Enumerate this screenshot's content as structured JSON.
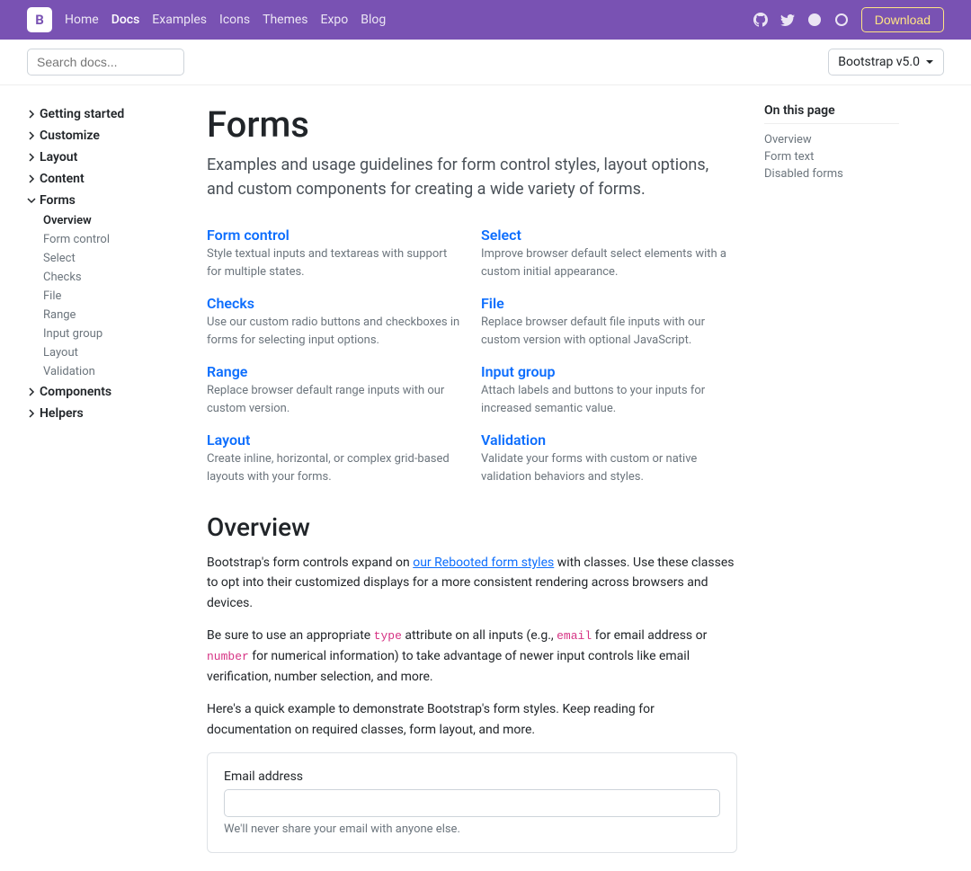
{
  "navbar": {
    "brand": "B",
    "links": [
      "Home",
      "Docs",
      "Examples",
      "Icons",
      "Themes",
      "Expo",
      "Blog"
    ],
    "active": "Docs",
    "download": "Download"
  },
  "subnav": {
    "search_placeholder": "Search docs...",
    "version": "Bootstrap v5.0"
  },
  "sidebar": {
    "sections": [
      "Getting started",
      "Customize",
      "Layout",
      "Content",
      "Forms",
      "Components",
      "Helpers"
    ],
    "expanded": "Forms",
    "sub": [
      "Overview",
      "Form control",
      "Select",
      "Checks",
      "File",
      "Range",
      "Input group",
      "Layout",
      "Validation"
    ],
    "active_sub": "Overview"
  },
  "main": {
    "title": "Forms",
    "lead": "Examples and usage guidelines for form control styles, layout options, and custom components for creating a wide variety of forms.",
    "grid": [
      {
        "title": "Form control",
        "desc": "Style textual inputs and textareas with support for multiple states."
      },
      {
        "title": "Select",
        "desc": "Improve browser default select elements with a custom initial appearance."
      },
      {
        "title": "Checks",
        "desc": "Use our custom radio buttons and checkboxes in forms for selecting input options."
      },
      {
        "title": "File",
        "desc": "Replace browser default file inputs with our custom version with optional JavaScript."
      },
      {
        "title": "Range",
        "desc": "Replace browser default range inputs with our custom version."
      },
      {
        "title": "Input group",
        "desc": "Attach labels and buttons to your inputs for increased semantic value."
      },
      {
        "title": "Layout",
        "desc": "Create inline, horizontal, or complex grid-based layouts with your forms."
      },
      {
        "title": "Validation",
        "desc": "Validate your forms with custom or native validation behaviors and styles."
      }
    ],
    "overview_title": "Overview",
    "p1_a": "Bootstrap's form controls expand on ",
    "p1_link": "our Rebooted form styles",
    "p1_b": " with classes. Use these classes to opt into their customized displays for a more consistent rendering across browsers and devices.",
    "p2_a": "Be sure to use an appropriate ",
    "p2_c1": "type",
    "p2_b": " attribute on all inputs (e.g., ",
    "p2_c2": "email",
    "p2_c": " for email address or ",
    "p2_c3": "number",
    "p2_d": " for numerical information) to take advantage of newer input controls like email verification, number selection, and more.",
    "p3": "Here's a quick example to demonstrate Bootstrap's form styles. Keep reading for documentation on required classes, form layout, and more.",
    "email_label": "Email address",
    "email_help": "We'll never share your email with anyone else."
  },
  "toc": {
    "title": "On this page",
    "items": [
      "Overview",
      "Form text",
      "Disabled forms"
    ]
  }
}
